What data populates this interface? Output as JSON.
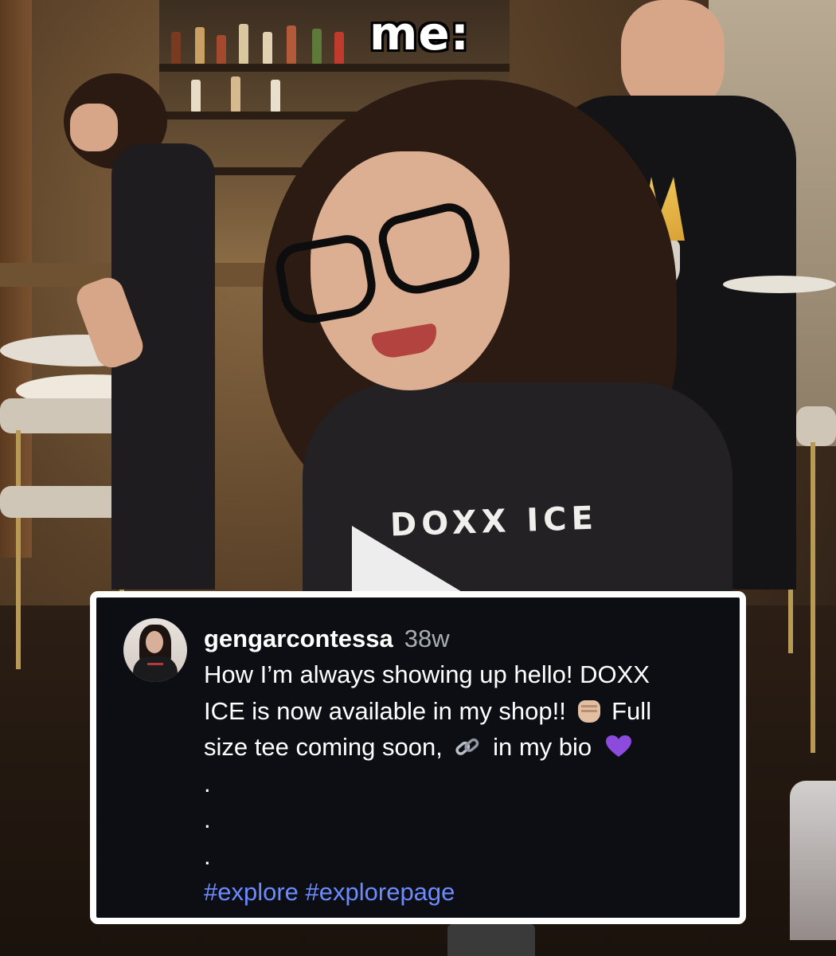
{
  "overlay": {
    "text": "me:"
  },
  "shirt_print": "DOXX ICE",
  "post": {
    "username": "gengarcontessa",
    "time_ago": "38w",
    "caption_lines": [
      "How I’m always showing up hello! DOXX",
      "ICE is now available in my shop!!",
      "Full",
      "size tee coming soon,",
      "in my bio"
    ],
    "dots": [
      ".",
      ".",
      "."
    ],
    "hashtags": "#explore #explorepage",
    "emojis": [
      "raised-fist-emoji",
      "link-emoji",
      "purple-heart-emoji"
    ]
  },
  "colors": {
    "card_bg": "#0c0e13",
    "card_border": "#ffffff",
    "hashtag": "#6b8bff",
    "timestamp": "#a8acb3",
    "heart": "#8c4bdc"
  }
}
